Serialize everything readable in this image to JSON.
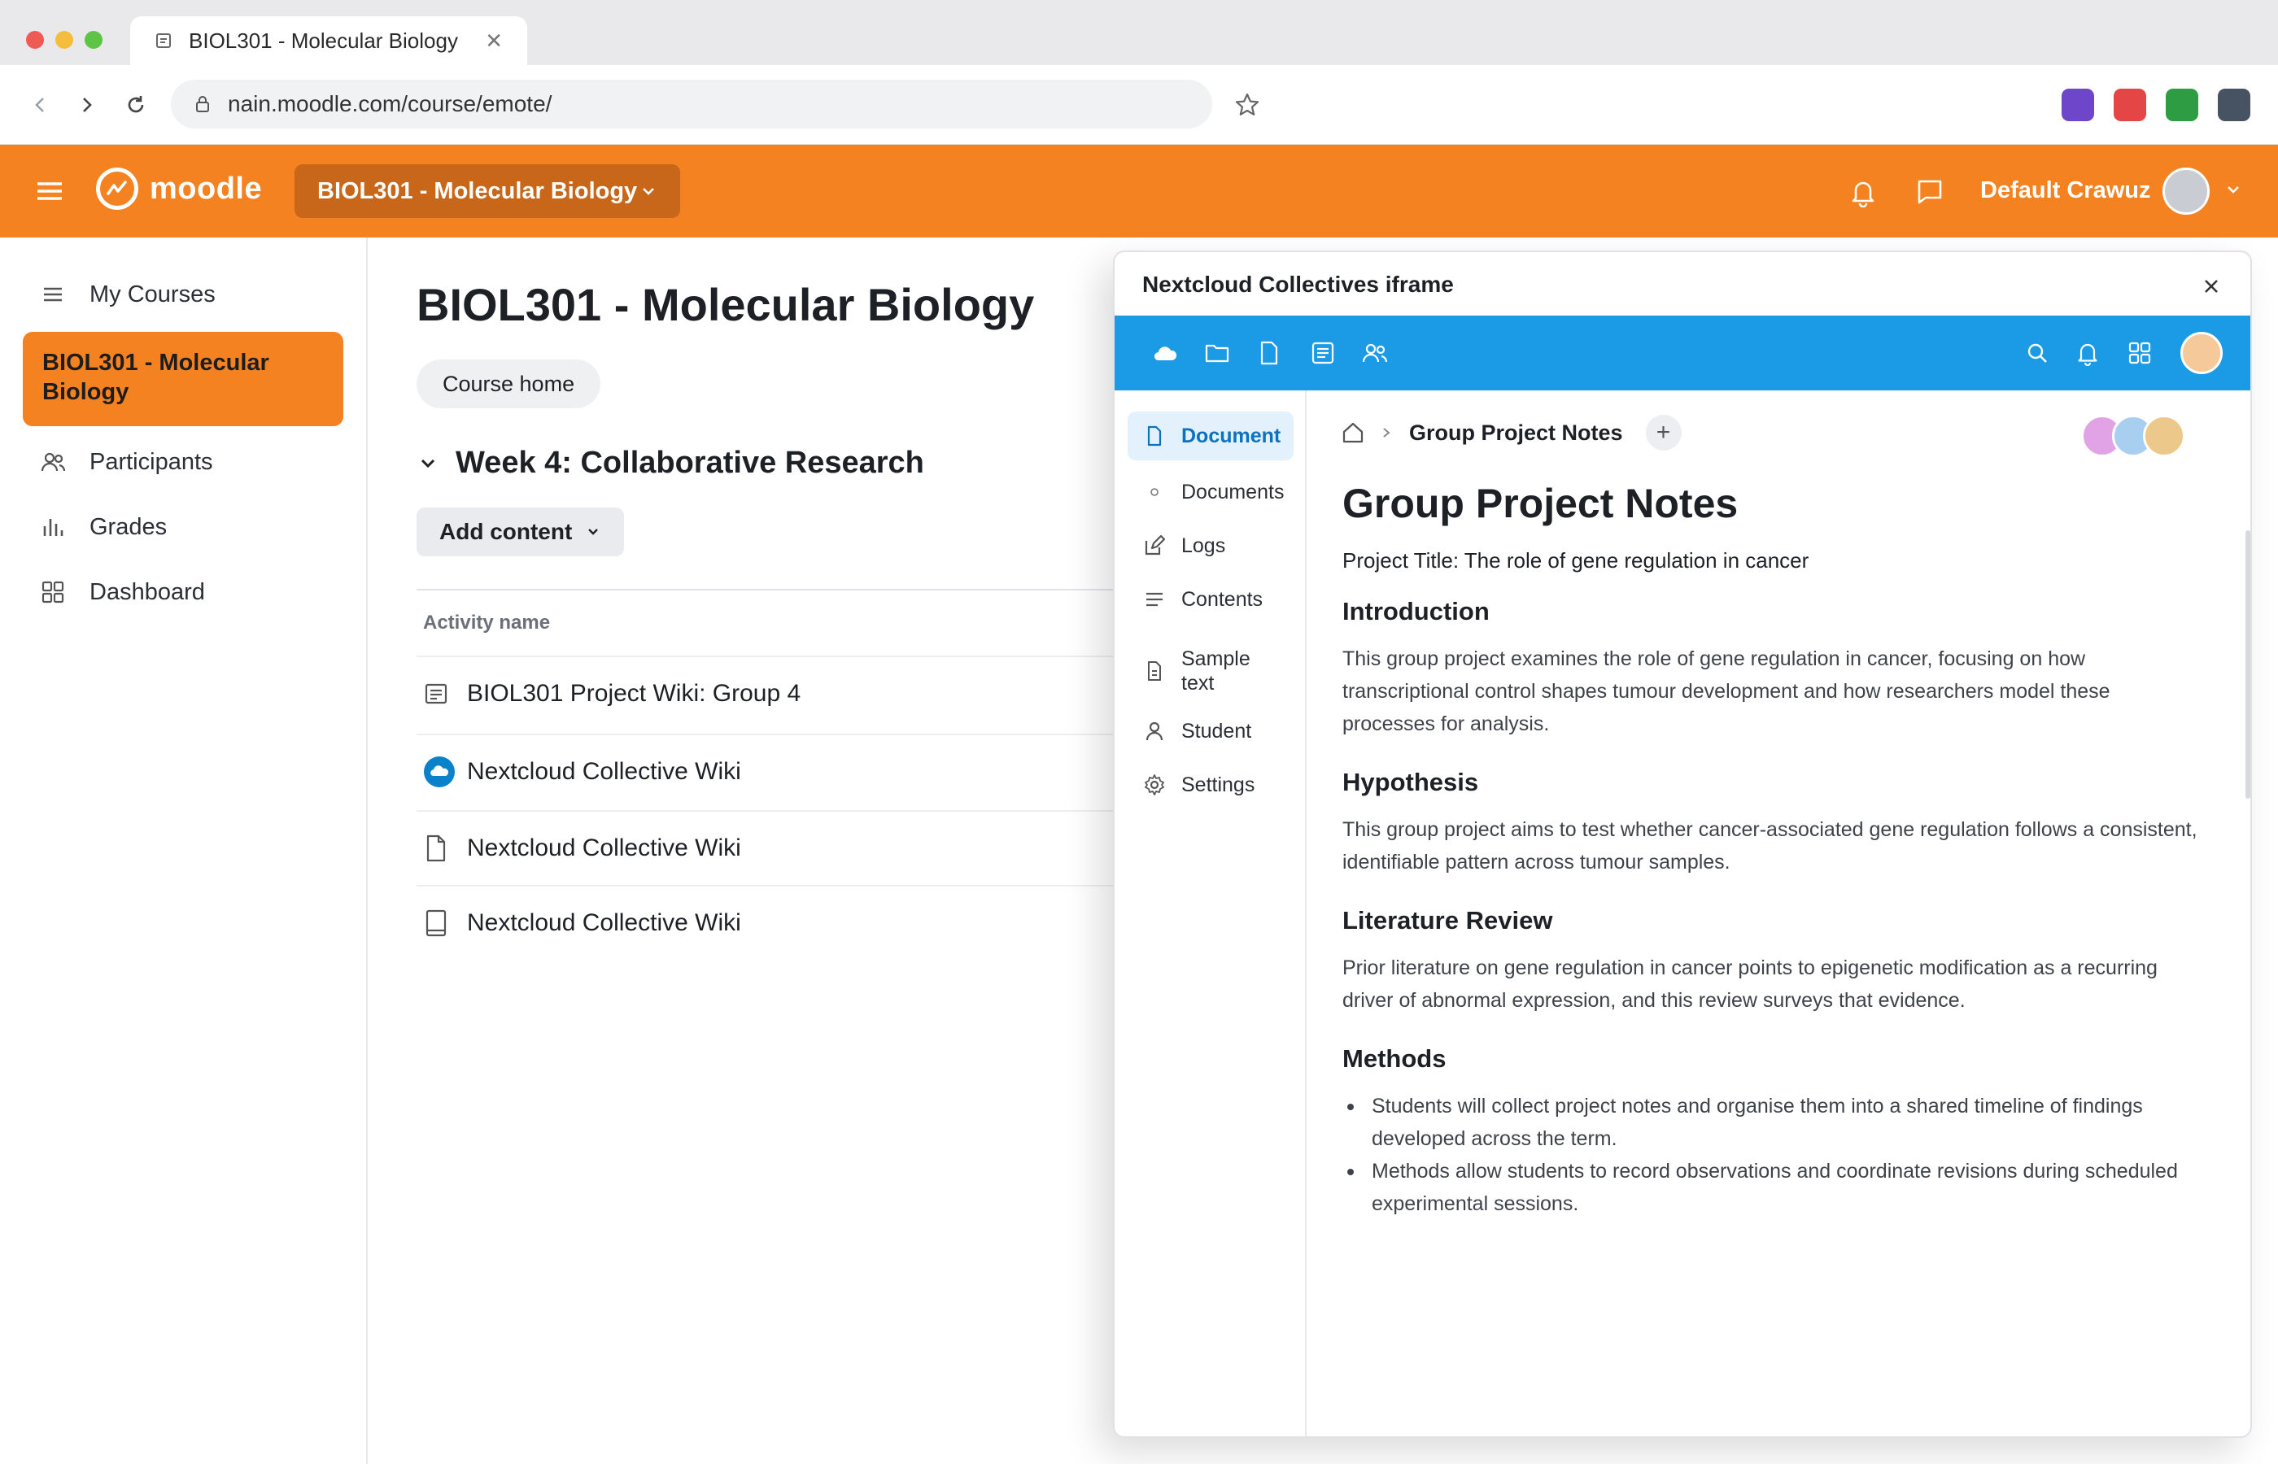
{
  "browser": {
    "tab_title": "BIOL301 - Molecular Biology",
    "url": "nain.moodle.com/course/emote/",
    "extension_colors": [
      "#6e46c9",
      "#e44545",
      "#2e9c43",
      "#475262"
    ]
  },
  "header": {
    "logo_text": "moodle",
    "course_selector": "BIOL301 - Molecular Biology",
    "user_name": "Default Crawuz",
    "accent_color": "#f58220"
  },
  "sidebar": {
    "items": [
      {
        "label": "My Courses",
        "icon": "list-icon"
      },
      {
        "label": "BIOL301 - Molecular Biology",
        "active": true
      },
      {
        "label": "Participants",
        "icon": "users-icon"
      },
      {
        "label": "Grades",
        "icon": "bar-chart-icon"
      },
      {
        "label": "Dashboard",
        "icon": "grid-icon"
      }
    ]
  },
  "main": {
    "title": "BIOL301 - Molecular Biology",
    "course_home": "Course home",
    "section_title": "Week 4: Collaborative Research",
    "add_content": "Add content",
    "table_header": "Activity name",
    "activities": [
      {
        "name": "BIOL301 Project Wiki: Group 4",
        "icon": "wiki-icon"
      },
      {
        "name": "Nextcloud Collective Wiki",
        "icon": "nextcloud-icon"
      },
      {
        "name": "Nextcloud Collective Wiki",
        "icon": "file-icon"
      },
      {
        "name": "Nextcloud Collective Wiki",
        "icon": "book-icon"
      }
    ]
  },
  "modal": {
    "title": "Nextcloud Collectives iframe",
    "nextcloud_color": "#1b9be6",
    "nav": [
      {
        "label": "Document",
        "icon": "document-icon",
        "active": true
      },
      {
        "label": "Documents",
        "icon": "dot-icon"
      },
      {
        "label": "Logs",
        "icon": "edit-icon"
      },
      {
        "label": "Contents",
        "icon": "lines-icon"
      },
      {
        "label": "Sample text",
        "icon": "page-icon"
      },
      {
        "label": "Student",
        "icon": "person-icon"
      },
      {
        "label": "Settings",
        "icon": "gear-icon"
      }
    ],
    "breadcrumb": "Group Project Notes",
    "doc": {
      "title": "Group Project Notes",
      "subtitle": "Project Title: The role of gene regulation in cancer",
      "intro_heading": "Introduction",
      "intro_text": "This group project examines the role of gene regulation in cancer, focusing on how transcriptional control shapes tumour development and how researchers model these processes for analysis.",
      "hypothesis_heading": "Hypothesis",
      "hypothesis_text": "This group project aims to test whether cancer-associated gene regulation follows a consistent, identifiable pattern across tumour samples.",
      "lit_heading": "Literature Review",
      "lit_text": "Prior literature on gene regulation in cancer points to epigenetic modification as a recurring driver of abnormal expression, and this review surveys that evidence.",
      "methods_heading": "Methods",
      "methods_items": [
        "Students will collect project notes and organise them into a shared timeline of findings developed across the term.",
        "Methods allow students to record observations and coordinate revisions during scheduled experimental sessions."
      ]
    }
  }
}
